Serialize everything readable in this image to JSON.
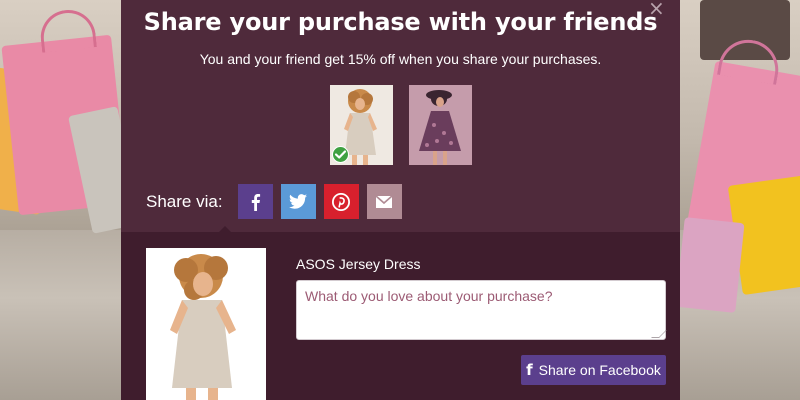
{
  "modal": {
    "close_glyph": "×",
    "title": "Share your purchase with your friends",
    "subtitle": "You and your friend get 15% off when you share your purchases."
  },
  "thumbnails": [
    {
      "name": "thumbnail-dress-selected",
      "selected": true
    },
    {
      "name": "thumbnail-dress-floral",
      "selected": false
    }
  ],
  "share": {
    "label": "Share via:",
    "buttons": [
      {
        "name": "facebook-share-button",
        "icon": "facebook-icon",
        "color": "#5b3f8d"
      },
      {
        "name": "twitter-share-button",
        "icon": "twitter-icon",
        "color": "#5b9ad8"
      },
      {
        "name": "pinterest-share-button",
        "icon": "pinterest-icon",
        "color": "#d8202d"
      },
      {
        "name": "email-share-button",
        "icon": "envelope-icon",
        "color": "#b08b94"
      }
    ]
  },
  "product": {
    "name": "ASOS Jersey Dress",
    "comment_placeholder": "What do you love about your purchase?",
    "comment_value": "",
    "share_button_label": "Share on Facebook"
  },
  "colors": {
    "modal_bg": "#4f2a3b",
    "lower_panel_bg": "#3f1d2d",
    "accent_purple": "#5b3f8d",
    "check_green": "#3fa142"
  }
}
